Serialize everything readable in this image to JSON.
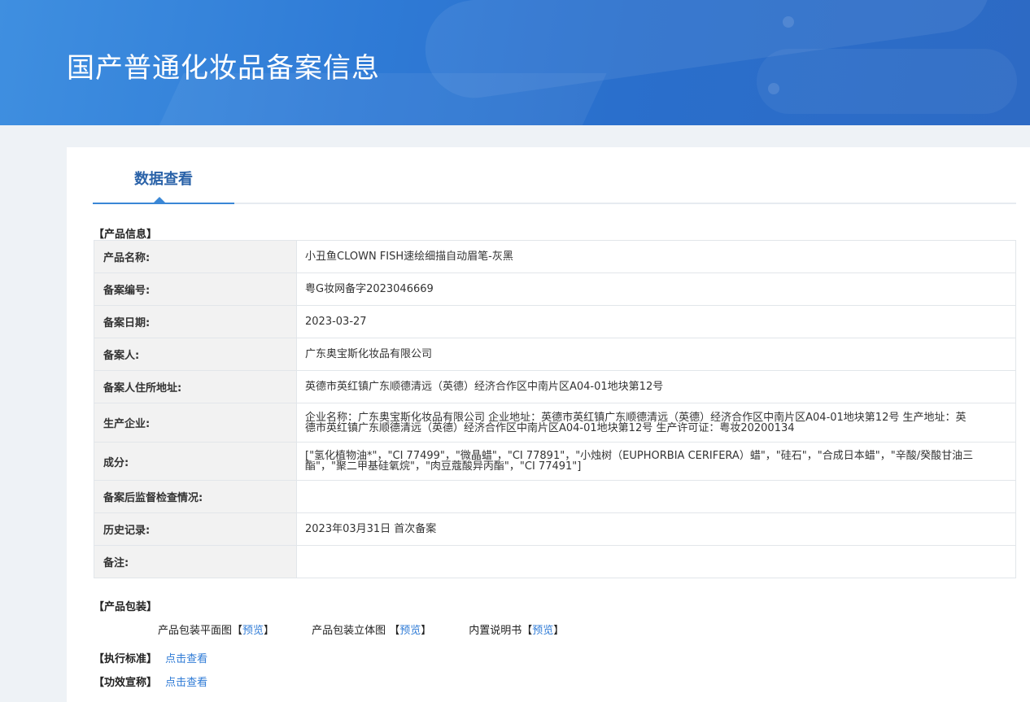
{
  "header": {
    "title": "国产普通化妆品备案信息"
  },
  "tab": {
    "label": "数据查看"
  },
  "product_info": {
    "section_label": "【产品信息】",
    "rows": [
      {
        "key": "产品名称:",
        "value": "小丑鱼CLOWN FISH速绘细描自动眉笔-灰黑"
      },
      {
        "key": "备案编号:",
        "value": "粤G妆网备字2023046669"
      },
      {
        "key": "备案日期:",
        "value": "2023-03-27"
      },
      {
        "key": "备案人:",
        "value": "广东奥宝斯化妆品有限公司"
      },
      {
        "key": "备案人住所地址:",
        "value": "英德市英红镇广东顺德清远（英德）经济合作区中南片区A04-01地块第12号"
      },
      {
        "key": "生产企业:",
        "value": "企业名称：广东奥宝斯化妆品有限公司 企业地址：英德市英红镇广东顺德清远（英德）经济合作区中南片区A04-01地块第12号 生产地址：英德市英红镇广东顺德清远（英德）经济合作区中南片区A04-01地块第12号 生产许可证：粤妆20200134"
      },
      {
        "key": "成分:",
        "value": "[\"氢化植物油*\"，\"CI 77499\"，\"微晶蜡\"，\"CI 77891\"，\"小烛树（EUPHORBIA CERIFERA）蜡\"，\"硅石\"，\"合成日本蜡\"，\"辛酸/癸酸甘油三酯\"，\"聚二甲基硅氧烷\"，\"肉豆蔻酸异丙酯\"，\"CI 77491\"]"
      },
      {
        "key": "备案后监督检查情况:",
        "value": ""
      },
      {
        "key": "历史记录:",
        "value": "2023年03月31日 首次备案"
      },
      {
        "key": "备注:",
        "value": ""
      }
    ]
  },
  "packaging": {
    "section_label": "【产品包装】",
    "items": [
      {
        "label": "产品包装平面图",
        "link": "预览"
      },
      {
        "label": "产品包装立体图 ",
        "link": "预览"
      },
      {
        "label": "内置说明书",
        "link": "预览"
      }
    ]
  },
  "standard": {
    "label": "【执行标准】",
    "link": "点击查看"
  },
  "efficacy": {
    "label": "【功效宣称】",
    "link": "点击查看"
  },
  "colors": {
    "accent": "#2f7bd6",
    "tab_text": "#2a62a8",
    "table_border": "#a9c6e6"
  }
}
